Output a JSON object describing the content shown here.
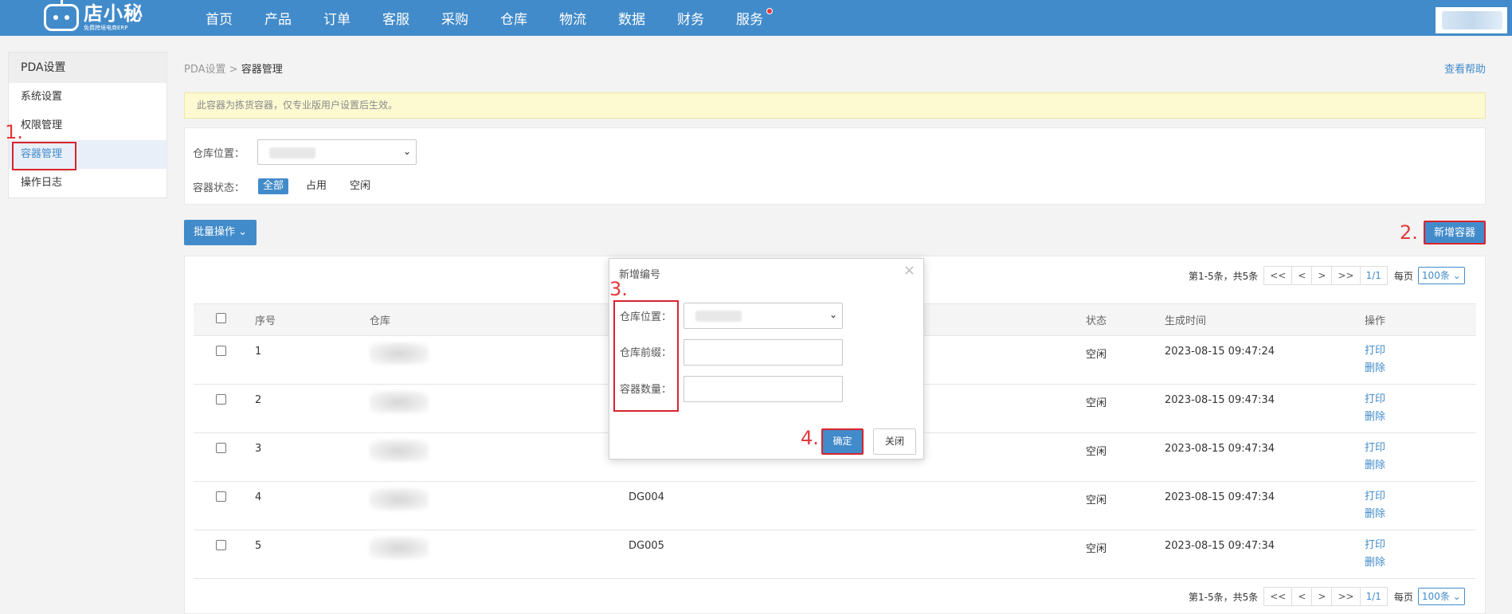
{
  "brand": {
    "name": "店小秘",
    "sub": "免费跨境电商ERP"
  },
  "nav": [
    "首页",
    "产品",
    "订单",
    "客服",
    "采购",
    "仓库",
    "物流",
    "数据",
    "财务",
    "服务"
  ],
  "sidebar": {
    "title": "PDA设置",
    "items": [
      "系统设置",
      "权限管理",
      "容器管理",
      "操作日志"
    ],
    "active_index": 2
  },
  "breadcrumb": {
    "parent": "PDA设置",
    "sep": ">",
    "current": "容器管理"
  },
  "help_link": "查看帮助",
  "notice": "此容器为拣货容器，仅专业版用户设置后生效。",
  "filters": {
    "warehouse_label": "仓库位置：",
    "status_label": "容器状态：",
    "status_options": [
      "全部",
      "占用",
      "空闲"
    ],
    "status_active": "全部"
  },
  "toolbar": {
    "batch_label": "批量操作",
    "add_label": "新增容器"
  },
  "pager": {
    "summary": "第1-5条，共5条",
    "buttons": [
      "<<",
      "<",
      ">",
      ">>"
    ],
    "page": "1/1",
    "per_page_label": "每页",
    "per_page_value": "100条"
  },
  "table": {
    "headers": [
      "序号",
      "仓库",
      "",
      "状态",
      "生成时间",
      "操作"
    ],
    "rows": [
      {
        "no": "1",
        "code": "",
        "status": "空闲",
        "time": "2023-08-15 09:47:24"
      },
      {
        "no": "2",
        "code": "",
        "status": "空闲",
        "time": "2023-08-15 09:47:34"
      },
      {
        "no": "3",
        "code": "",
        "status": "空闲",
        "time": "2023-08-15 09:47:34"
      },
      {
        "no": "4",
        "code": "DG004",
        "status": "空闲",
        "time": "2023-08-15 09:47:34"
      },
      {
        "no": "5",
        "code": "DG005",
        "status": "空闲",
        "time": "2023-08-15 09:47:34"
      }
    ],
    "action_print": "打印",
    "action_delete": "删除"
  },
  "modal": {
    "title": "新增编号",
    "close": "×",
    "fields": [
      "仓库位置：",
      "仓库前缀：",
      "容器数量："
    ],
    "confirm": "确定",
    "cancel": "关闭"
  },
  "annotations": [
    "1.",
    "2.",
    "3.",
    "4."
  ],
  "colors": {
    "primary": "#428bca",
    "annotation": "#e4393c",
    "notice_bg": "#fdf9d1"
  }
}
